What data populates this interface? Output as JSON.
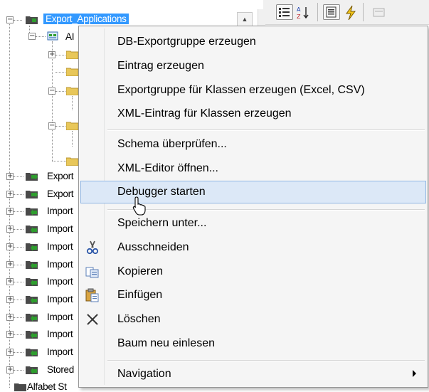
{
  "tree": {
    "root": "Export_Applications",
    "child": "AI",
    "siblings": [
      "Export",
      "Export",
      "Import",
      "Import",
      "Import",
      "Import",
      "Import",
      "Import",
      "Import",
      "Import",
      "Import",
      "Stored"
    ],
    "last": "Alfabet St"
  },
  "menu": {
    "items": [
      {
        "label": "DB-Exportgruppe erzeugen",
        "icon": null
      },
      {
        "label": "Eintrag erzeugen",
        "icon": null
      },
      {
        "label": "Exportgruppe für Klassen erzeugen (Excel, CSV)",
        "icon": null
      },
      {
        "label": "XML-Eintrag für Klassen erzeugen",
        "icon": null
      },
      {
        "label": "Schema überprüfen...",
        "icon": null
      },
      {
        "label": "XML-Editor öffnen...",
        "icon": null
      },
      {
        "label": "Debugger starten",
        "icon": null
      },
      {
        "label": "Speichern unter...",
        "icon": null
      },
      {
        "label": "Ausschneiden",
        "icon": "scissors-icon"
      },
      {
        "label": "Kopieren",
        "icon": "copy-icon"
      },
      {
        "label": "Einfügen",
        "icon": "paste-icon"
      },
      {
        "label": "Löschen",
        "icon": "delete-icon"
      },
      {
        "label": "Baum neu einlesen",
        "icon": null
      },
      {
        "label": "Navigation",
        "icon": null
      }
    ]
  },
  "colors": {
    "selection": "#3399ff",
    "menu_background": "#f5f5f5",
    "menu_highlight": "#dce8f7",
    "folder_green": "#2e9e2e",
    "folder_dark": "#4a4a4a",
    "folder_yellow": "#e8c75a"
  }
}
